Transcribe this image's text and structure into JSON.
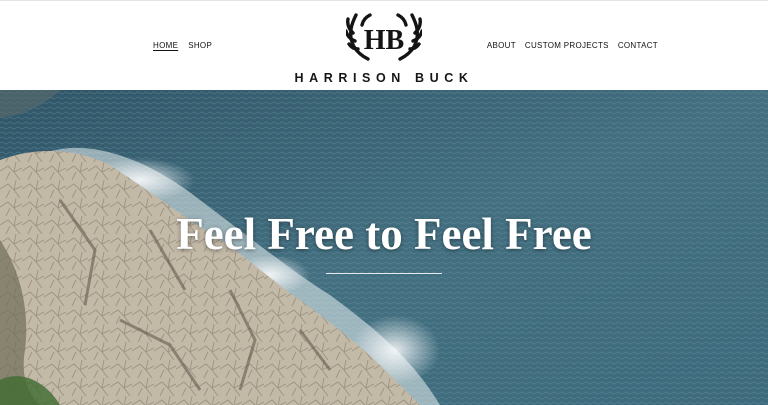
{
  "header": {
    "nav_left": [
      "HOME",
      "SHOP"
    ],
    "nav_right": [
      "ABOUT",
      "CUSTOM PROJECTS",
      "CONTACT"
    ],
    "active_item": "HOME",
    "logo": {
      "monogram": "HB",
      "name": "HARRISON BUCK"
    }
  },
  "hero": {
    "title": "Feel Free to Feel Free",
    "image": "aerial-rocky-coastline-ocean"
  },
  "colors": {
    "header_bg": "#ffffff",
    "nav_text": "#111111",
    "ocean": "#3e6677",
    "rock": "#c7bca9",
    "hero_text": "#ffffff"
  }
}
